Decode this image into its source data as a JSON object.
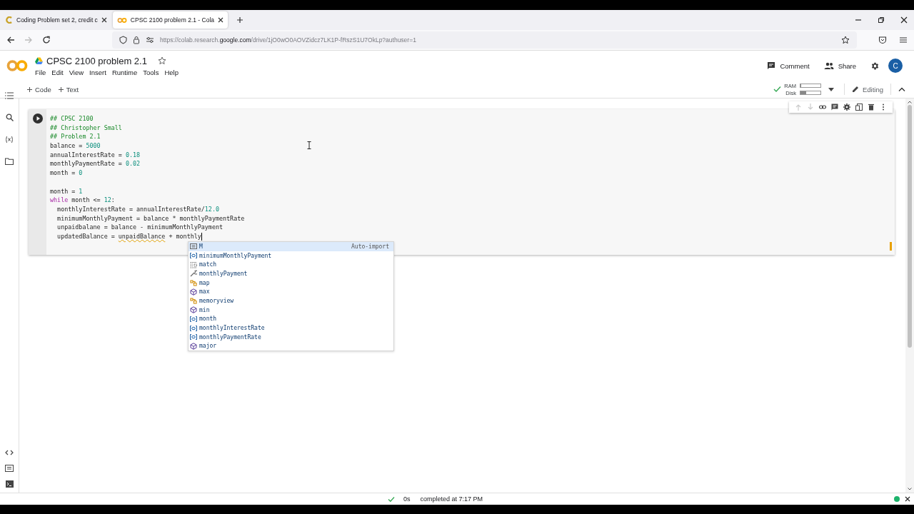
{
  "browser": {
    "tabs": [
      {
        "title": "Coding Problem set 2, credit c",
        "selected": false
      },
      {
        "title": "CPSC 2100 problem 2.1 - Cola",
        "selected": true
      }
    ],
    "url": "https://colab.research.**google.com**/drive/1jO0wO0AOVZidcz7LK1P-fRszS1U7OkLp?authuser=1"
  },
  "notebook": {
    "title": "CPSC 2100 problem 2.1",
    "menu": [
      "File",
      "Edit",
      "View",
      "Insert",
      "Runtime",
      "Tools",
      "Help"
    ],
    "actions": [
      {
        "kind": "comment",
        "label": "Comment"
      },
      {
        "kind": "share",
        "label": "Share"
      }
    ],
    "avatar": "C"
  },
  "toolbar": {
    "add": [
      "Code",
      "Text"
    ],
    "resources": [
      {
        "label": "RAM",
        "level": 0.05
      },
      {
        "label": "Disk",
        "level": 0.3
      }
    ],
    "mode": "Editing"
  },
  "cell": {
    "lines": [
      {
        "kind": "code",
        "tokens": [
          {
            "text": "## CPSC 2100",
            "kind": "comment"
          }
        ]
      },
      {
        "kind": "code",
        "tokens": [
          {
            "text": "## Christopher Small",
            "kind": "comment"
          }
        ]
      },
      {
        "kind": "code",
        "tokens": [
          {
            "text": "## Problem 2.1",
            "kind": "comment"
          }
        ]
      },
      {
        "kind": "code",
        "tokens": [
          {
            "text": "balance = ",
            "kind": "plain"
          },
          {
            "text": "5000",
            "kind": "number"
          }
        ]
      },
      {
        "kind": "code",
        "tokens": [
          {
            "text": "annualInterestRate = ",
            "kind": "plain"
          },
          {
            "text": "0.18",
            "kind": "number"
          }
        ]
      },
      {
        "kind": "code",
        "tokens": [
          {
            "text": "monthlyPaymentRate = ",
            "kind": "plain"
          },
          {
            "text": "0.02",
            "kind": "number"
          }
        ]
      },
      {
        "kind": "code",
        "tokens": [
          {
            "text": "month = ",
            "kind": "plain"
          },
          {
            "text": "0",
            "kind": "number"
          }
        ]
      },
      {
        "kind": "blank"
      },
      {
        "kind": "code",
        "tokens": [
          {
            "text": "month = ",
            "kind": "plain"
          },
          {
            "text": "1",
            "kind": "number"
          }
        ]
      },
      {
        "kind": "code",
        "tokens": [
          {
            "text": "while",
            "kind": "keyword"
          },
          {
            "text": " month <= ",
            "kind": "plain"
          },
          {
            "text": "12",
            "kind": "number"
          },
          {
            "text": ":",
            "kind": "plain"
          }
        ]
      },
      {
        "kind": "code",
        "tokens": [
          {
            "text": "  monthlyInterestRate = annualInterestRate/",
            "kind": "plain"
          },
          {
            "text": "12.0",
            "kind": "number"
          }
        ]
      },
      {
        "kind": "code",
        "tokens": [
          {
            "text": "  minimumMonthlyPayment = balance * monthlyPaymentRate",
            "kind": "plain"
          }
        ]
      },
      {
        "kind": "code",
        "tokens": [
          {
            "text": "  unpaidbalane = balance - minimumMonthlyPayment",
            "kind": "plain"
          }
        ]
      },
      {
        "kind": "code",
        "tokens": [
          {
            "text": "  updatedBalance = ",
            "kind": "plain"
          },
          {
            "text": "unpaidBalance",
            "kind": "warning"
          },
          {
            "text": " + monthly",
            "kind": "plain"
          }
        ]
      }
    ],
    "suggestions": [
      {
        "kind": "text",
        "label": "M",
        "detail": "Auto-import",
        "selected": true
      },
      {
        "kind": "variable",
        "label": "minimumMonthlyPayment",
        "selected": false
      },
      {
        "kind": "snippet",
        "label": "match",
        "selected": false
      },
      {
        "kind": "property",
        "label": "monthlyPayment",
        "selected": false
      },
      {
        "kind": "class",
        "label": "map",
        "selected": false
      },
      {
        "kind": "module",
        "label": "max",
        "selected": false
      },
      {
        "kind": "class",
        "label": "memoryview",
        "selected": false
      },
      {
        "kind": "module",
        "label": "min",
        "selected": false
      },
      {
        "kind": "variable",
        "label": "month",
        "selected": false
      },
      {
        "kind": "variable",
        "label": "monthlyInterestRate",
        "selected": false
      },
      {
        "kind": "variable",
        "label": "monthlyPaymentRate",
        "selected": false
      },
      {
        "kind": "module",
        "label": "major",
        "selected": false
      }
    ]
  },
  "status": {
    "duration": "0s",
    "message": "completed at 7:17 PM"
  }
}
